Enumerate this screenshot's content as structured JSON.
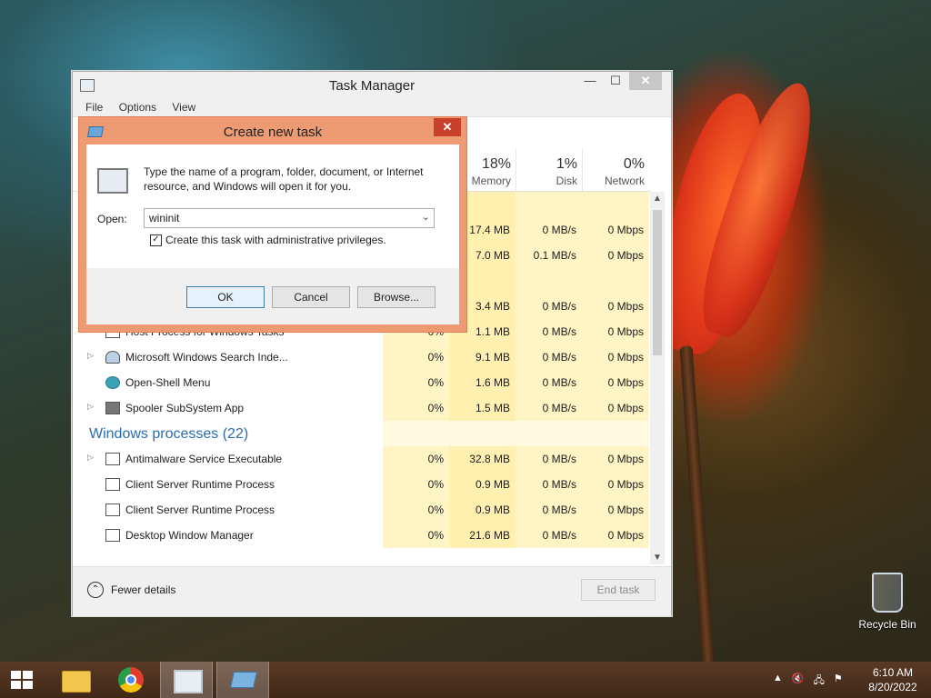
{
  "task_manager": {
    "title": "Task Manager",
    "menu": [
      "File",
      "Options",
      "View"
    ],
    "window_buttons": {
      "minimize": "—",
      "maximize": "☐",
      "close": "✕"
    },
    "columns": [
      {
        "pct": "18%",
        "label": "Memory"
      },
      {
        "pct": "1%",
        "label": "Disk"
      },
      {
        "pct": "0%",
        "label": "Network"
      }
    ],
    "rows": [
      {
        "name": "",
        "cpu": "",
        "mem": "",
        "disk": "",
        "net": ""
      },
      {
        "name": "",
        "cpu": "",
        "mem": "17.4 MB",
        "disk": "0 MB/s",
        "net": "0 Mbps"
      },
      {
        "name": "",
        "cpu": "",
        "mem": "7.0 MB",
        "disk": "0.1 MB/s",
        "net": "0 Mbps"
      },
      {
        "name": "",
        "cpu": "",
        "mem": "",
        "disk": "",
        "net": ""
      },
      {
        "name": "",
        "cpu": "",
        "mem": "3.4 MB",
        "disk": "0 MB/s",
        "net": "0 Mbps"
      },
      {
        "name": "Host Process for Windows Tasks",
        "cpu": "0%",
        "mem": "1.1 MB",
        "disk": "0 MB/s",
        "net": "0 Mbps"
      },
      {
        "name": "Microsoft Windows Search Inde...",
        "cpu": "0%",
        "mem": "9.1 MB",
        "disk": "0 MB/s",
        "net": "0 Mbps"
      },
      {
        "name": "Open-Shell Menu",
        "cpu": "0%",
        "mem": "1.6 MB",
        "disk": "0 MB/s",
        "net": "0 Mbps"
      },
      {
        "name": "Spooler SubSystem App",
        "cpu": "0%",
        "mem": "1.5 MB",
        "disk": "0 MB/s",
        "net": "0 Mbps"
      },
      {
        "name": "",
        "cpu": "",
        "mem": "",
        "disk": "",
        "net": ""
      },
      {
        "name": "Antimalware Service Executable",
        "cpu": "0%",
        "mem": "32.8 MB",
        "disk": "0 MB/s",
        "net": "0 Mbps"
      },
      {
        "name": "Client Server Runtime Process",
        "cpu": "0%",
        "mem": "0.9 MB",
        "disk": "0 MB/s",
        "net": "0 Mbps"
      },
      {
        "name": "Client Server Runtime Process",
        "cpu": "0%",
        "mem": "0.9 MB",
        "disk": "0 MB/s",
        "net": "0 Mbps"
      },
      {
        "name": "Desktop Window Manager",
        "cpu": "0%",
        "mem": "21.6 MB",
        "disk": "0 MB/s",
        "net": "0 Mbps"
      }
    ],
    "group_windows": "Windows processes (22)",
    "fewer_details": "Fewer details",
    "end_task": "End task",
    "expand_glyph": "▷",
    "fewer_glyph": "⌃",
    "scroll_up": "▲",
    "scroll_down": "▼"
  },
  "dialog": {
    "title": "Create new task",
    "close": "✕",
    "message": "Type the name of a program, folder, document, or Internet resource, and Windows will open it for you.",
    "open_label": "Open:",
    "open_value": "wininit",
    "dropdown_glyph": "⌄",
    "checkbox_label": "Create this task with administrative privileges.",
    "checkbox_mark": "✓",
    "buttons": {
      "ok": "OK",
      "cancel": "Cancel",
      "browse": "Browse..."
    }
  },
  "desktop": {
    "recycle_bin": "Recycle Bin"
  },
  "taskbar": {
    "clock_time": "6:10 AM",
    "clock_date": "8/20/2022",
    "tray": {
      "chevron": "▲",
      "volume": "🔇",
      "network": "🖧",
      "flag": "⚑"
    }
  }
}
